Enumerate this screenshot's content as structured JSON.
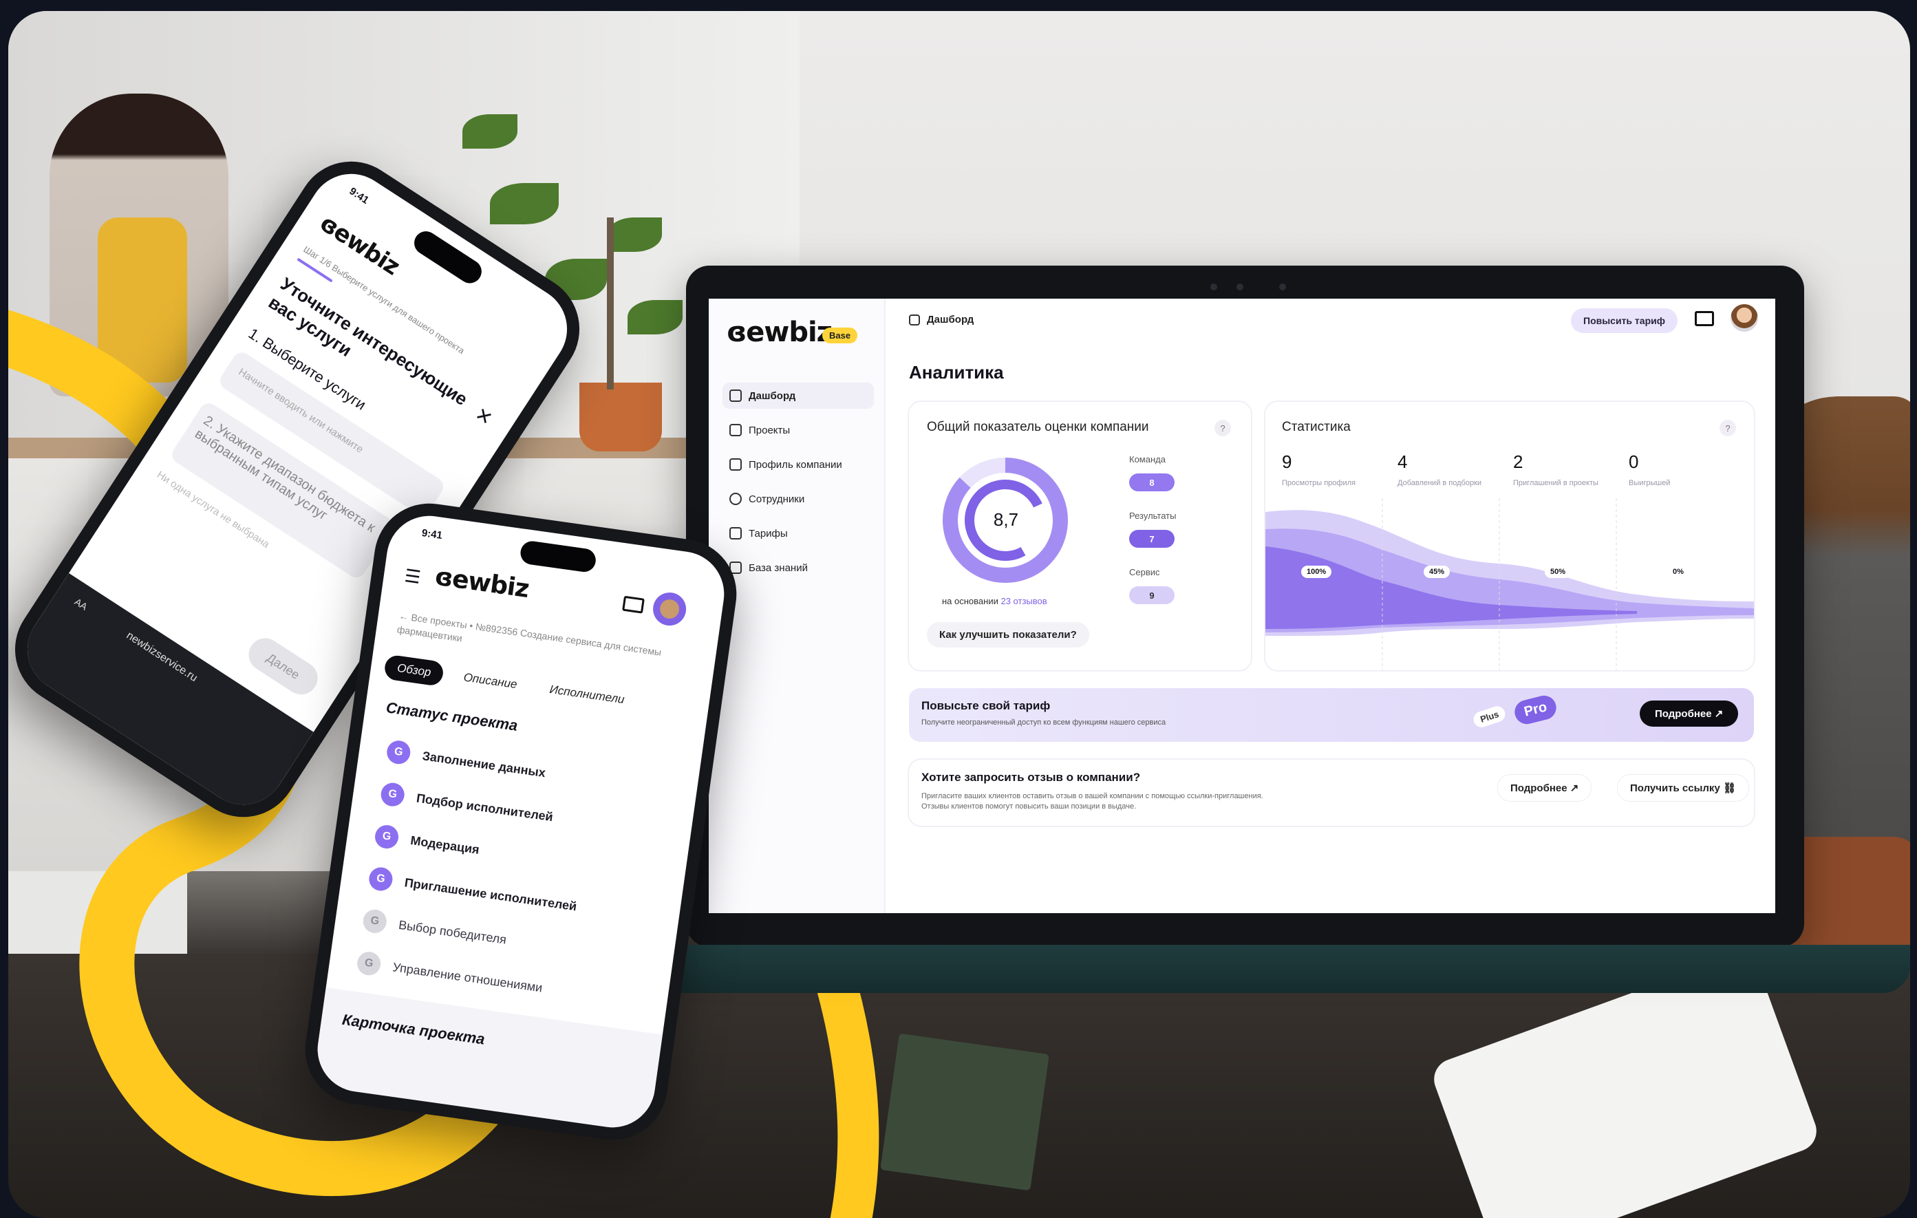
{
  "colors": {
    "accent": "#8c6ff0",
    "accent_light": "#c9bcf6",
    "yellow": "#ffc91f",
    "dark": "#0d0d12"
  },
  "laptop": {
    "logo": "ɞewbiz",
    "plan_badge": "Base",
    "sidebar": [
      {
        "label": "Дашборд",
        "icon": "grid-icon",
        "active": true
      },
      {
        "label": "Проекты",
        "icon": "folder-icon"
      },
      {
        "label": "Профиль компании",
        "icon": "building-icon"
      },
      {
        "label": "Сотрудники",
        "icon": "users-icon"
      },
      {
        "label": "Тарифы",
        "icon": "tariff-icon"
      },
      {
        "label": "База знаний",
        "icon": "book-icon"
      }
    ],
    "breadcrumb": "Дашборд",
    "upgrade_button": "Повысить тариф",
    "page_title": "Аналитика",
    "rating_card": {
      "title": "Общий показатель оценки компании",
      "score": "8,7",
      "based_on": "на основании",
      "reviews_link": "23 отзывов",
      "metrics": [
        {
          "label": "Команда",
          "value": "8"
        },
        {
          "label": "Результаты",
          "value": "7"
        },
        {
          "label": "Сервис",
          "value": "9"
        }
      ],
      "improve_button": "Как улучшить показатели?"
    },
    "stats_card": {
      "title": "Статистика",
      "items": [
        {
          "value": "9",
          "label": "Просмотры профиля",
          "pct": "100%"
        },
        {
          "value": "4",
          "label": "Добавлений в подборки",
          "pct": "45%"
        },
        {
          "value": "2",
          "label": "Приглашений в проекты",
          "pct": "50%"
        },
        {
          "value": "0",
          "label": "Выигрышей",
          "pct": "0%"
        }
      ]
    },
    "promo": {
      "title": "Повысьте свой тариф",
      "subtitle": "Получите неограниченный доступ ко всем функциям нашего сервиса",
      "badge_plus": "Plus",
      "badge_pro": "Pro",
      "button": "Подробнее"
    },
    "review": {
      "title": "Хотите запросить отзыв о компании?",
      "text": "Пригласите ваших клиентов оставить отзыв о вашей компании с помощью ссылки-приглашения. Отзывы клиентов помогут повысить ваши позиции в выдаче.",
      "more_button": "Подробнее",
      "link_button": "Получить ссылку"
    }
  },
  "phone_left": {
    "time": "9:41",
    "logo": "ɞewbiz",
    "step": "Шаг 1/6",
    "step_hint": "Выберите услуги для вашего проекта",
    "heading": "Уточните интересующие вас услуги",
    "q1": "1. Выберите услуги",
    "q1_placeholder": "Начните вводить или нажмите",
    "q2": "2. Укажите диапазон бюджета к выбранным типам услуг",
    "q2_hint": "Ни одна услуга не выбрана",
    "next_button": "Далее",
    "url": "newbizservice.ru",
    "aa": "AA"
  },
  "phone_right": {
    "time": "9:41",
    "logo": "ɞewbiz",
    "breadcrumb_root": "Все проекты",
    "breadcrumb_item": "№892356 Создание сервиса для системы фармацевтики",
    "tabs": [
      "Обзор",
      "Описание",
      "Исполнители"
    ],
    "status_title": "Статус проекта",
    "steps": [
      {
        "label": "Заполнение данных",
        "done": true
      },
      {
        "label": "Подбор исполнителей",
        "done": true
      },
      {
        "label": "Модерация",
        "done": true
      },
      {
        "label": "Приглашение исполнителей",
        "done": true
      },
      {
        "label": "Выбор победителя",
        "done": false
      },
      {
        "label": "Управление отношениями",
        "done": false
      }
    ],
    "card_title": "Карточка проекта"
  }
}
